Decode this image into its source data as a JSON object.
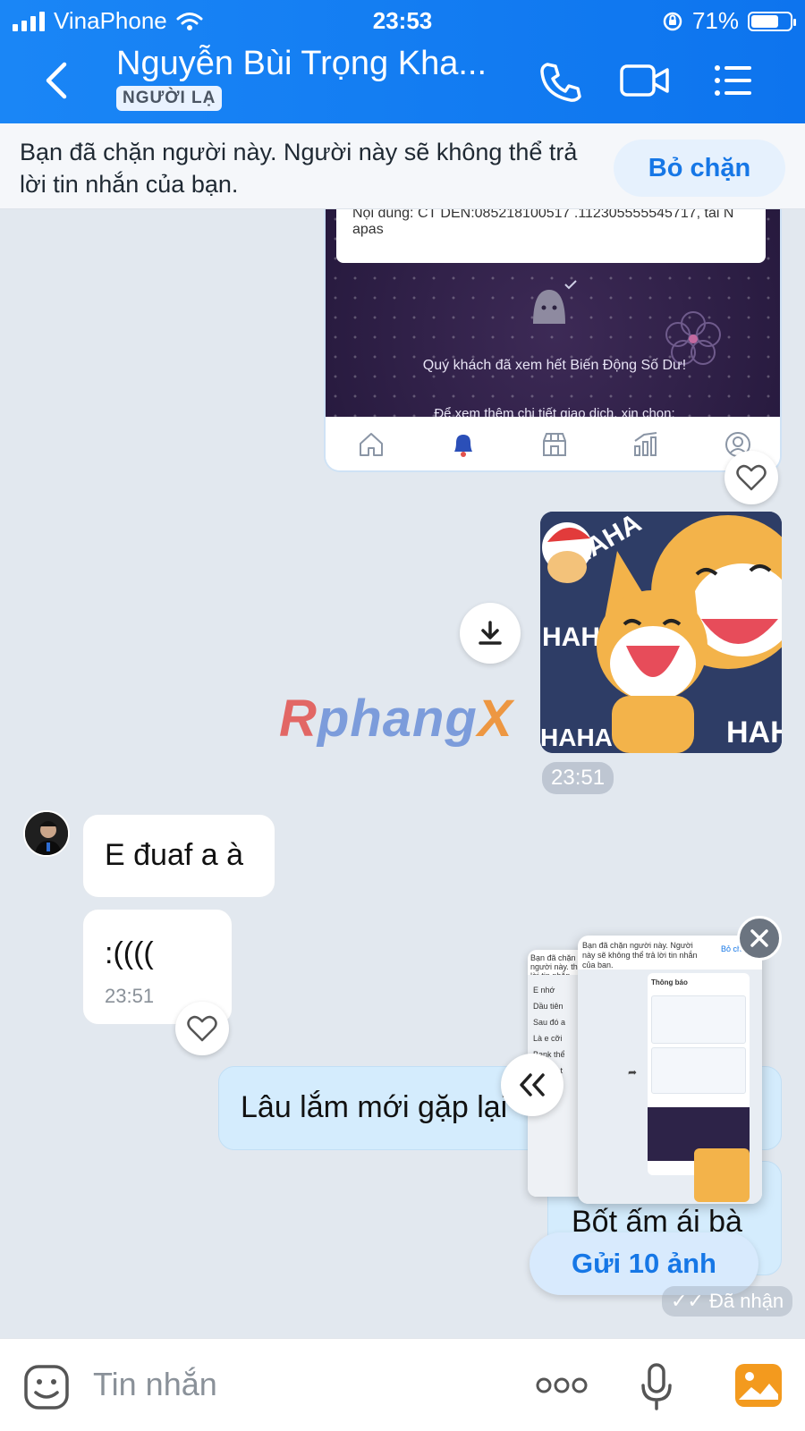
{
  "status_bar": {
    "carrier": "VinaPhone",
    "time": "23:53",
    "battery": "71%",
    "battery_level": 0.71
  },
  "header": {
    "back_icon": "chevron-left-icon",
    "title": "Nguyễn Bùi Trọng Kha...",
    "tag": "NGƯỜI LẠ",
    "colors": {
      "bar": "#0f78ef"
    }
  },
  "banner": {
    "text": "Bạn đã chặn người này. Người này sẽ không thể trả lời tin nhắn của bạn.",
    "unblock_label": "Bỏ chặn"
  },
  "shared_screenshot": {
    "card_text_1": "Nội dung: CT DEN:085218100517 .112305555545717, tai N",
    "card_text_2": "apas",
    "message": "Quý khách đã xem hết Biến Động Số Dư!",
    "message_2": "Để xem thêm chi tiết giao dịch, xin chọn:"
  },
  "sticker": {
    "text": "HAHA",
    "time": "23:51"
  },
  "watermark": {
    "part_r": "R",
    "part_mid": "phang",
    "part_x": "X"
  },
  "messages_in": [
    {
      "text": "E đuaf a à"
    },
    {
      "text": ":((((",
      "time": "23:51"
    }
  ],
  "messages_out": [
    {
      "text": "Lâu lắm mới gặp lại"
    },
    {
      "text": "Bốt ấm ái bà"
    }
  ],
  "floating_preview": {
    "front_header": "Bạn đã chặn người này. Người này sẽ không thể trả lời tin nhắn của bạn.",
    "front_unblock": "Bỏ ch",
    "front_title": "Thông báo",
    "back_header": "Bạn đã chặn người này. thể trả lời tin nhắn",
    "back_items": [
      "E nhớ",
      "Dầu tiên",
      "Sau đó a",
      "Là e cỡi",
      "Bank thể",
      "Ko thôi t"
    ],
    "send_label": "Gửi 10 ảnh"
  },
  "status": {
    "received": "Đã nhận"
  },
  "input": {
    "placeholder": "Tin nhắn"
  }
}
